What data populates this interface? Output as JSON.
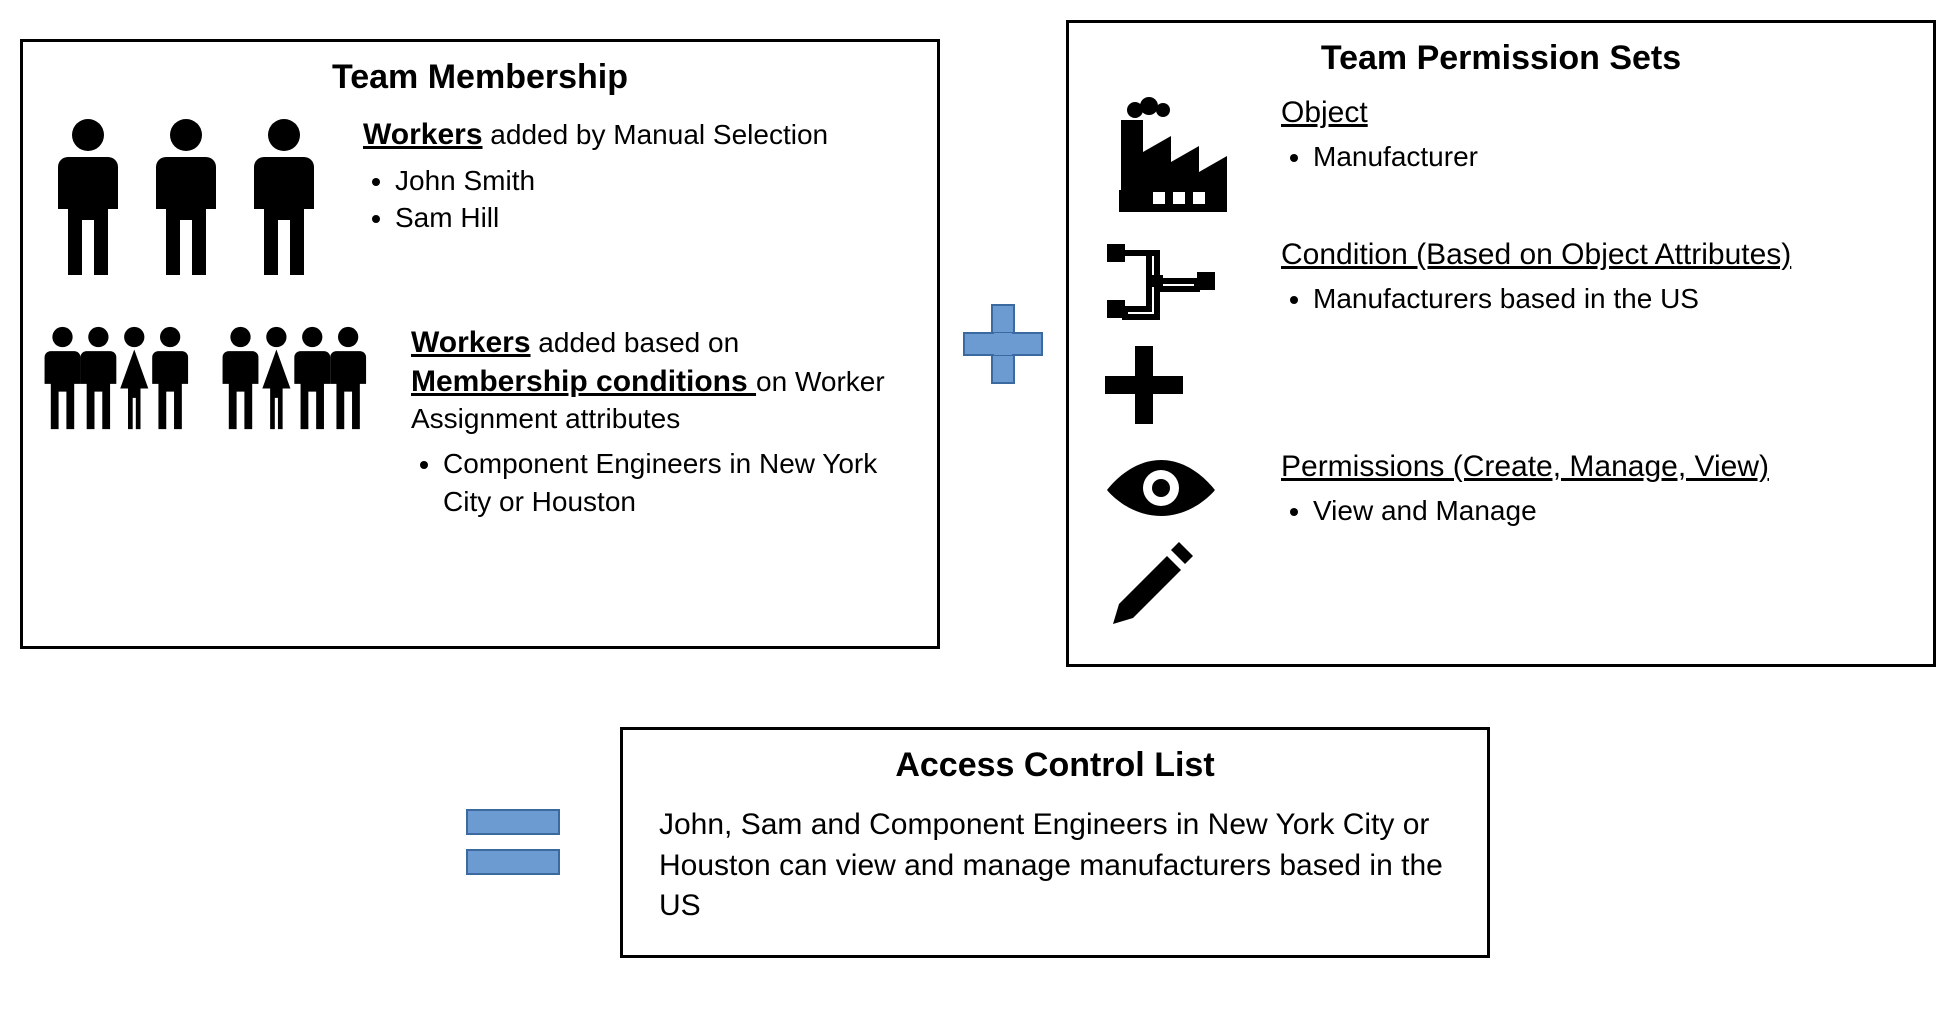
{
  "membership": {
    "title": "Team Membership",
    "manual": {
      "emph": "Workers",
      "tail": " added by Manual Selection",
      "items": [
        "John Smith",
        "Sam Hill"
      ]
    },
    "conditions": {
      "emph1": "Workers",
      "mid": " added based on ",
      "emph2": "Membership conditions ",
      "tail": "on Worker Assignment attributes",
      "items": [
        "Component Engineers in New York City or Houston"
      ]
    }
  },
  "permissionSets": {
    "title": "Team Permission Sets",
    "object": {
      "label": "Object",
      "items": [
        "Manufacturer"
      ]
    },
    "condition": {
      "label": "Condition (Based on Object Attributes)",
      "items": [
        "Manufacturers based in the US"
      ]
    },
    "permissions": {
      "label": "Permissions (Create, Manage, View)",
      "items": [
        "View and Manage"
      ]
    }
  },
  "acl": {
    "title": "Access Control List",
    "text": "John, Sam and Component Engineers in New York City or Houston can view and manage manufacturers based in the US"
  }
}
